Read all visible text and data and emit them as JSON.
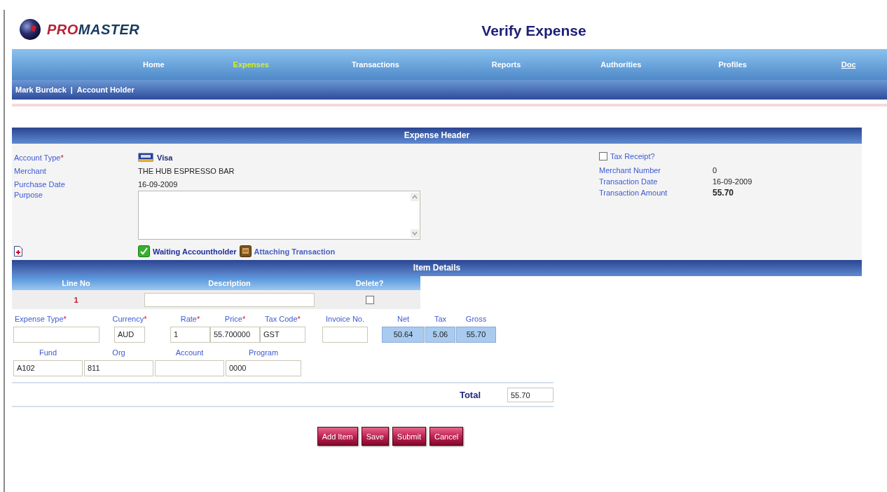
{
  "app": {
    "logo_parts": [
      {
        "text": "PRO",
        "kind": "accent"
      },
      {
        "text": "MASTER",
        "kind": "main"
      }
    ],
    "page_title": "Verify Expense"
  },
  "nav": [
    {
      "label": "Home",
      "selected": false
    },
    {
      "label": "Expenses",
      "selected": true
    },
    {
      "label": "Transactions",
      "selected": false
    },
    {
      "label": "Reports",
      "selected": false
    },
    {
      "label": "Authorities",
      "selected": false
    },
    {
      "label": "Profiles",
      "selected": false
    },
    {
      "label": "Doc",
      "selected": false,
      "kind": "link"
    }
  ],
  "user_bar": {
    "name": "Mark Burdack",
    "separator": "|",
    "role": "Account Holder"
  },
  "expense_header": {
    "title": "Expense Header",
    "left_fields": [
      {
        "label": "Account Type",
        "required": "*",
        "value": "Visa",
        "kind": "card"
      },
      {
        "label": "Merchant",
        "value": "THE HUB ESPRESSO BAR",
        "kind": "text"
      },
      {
        "label": "Purchase Date",
        "value": "16-09-2009",
        "kind": "text"
      },
      {
        "label": "Purpose",
        "kind": "textarea"
      }
    ],
    "tax_receipt": {
      "label": "Tax Receipt?",
      "checked": false
    },
    "right_fields": [
      {
        "label": "Merchant Number",
        "value": "0",
        "kind": "text"
      },
      {
        "label": "Transaction Date",
        "value": "16-09-2009",
        "kind": "text"
      },
      {
        "label": "Transaction Amount",
        "value": "55.70",
        "kind": "bold"
      }
    ],
    "statuses": [
      {
        "label": "Waiting Accountholder",
        "kind": "check"
      },
      {
        "label": "Attaching Transaction",
        "kind": "attach"
      }
    ]
  },
  "item_details": {
    "title": "Item Details",
    "columns": [
      "Line No",
      "Description",
      "Delete?"
    ],
    "rows": [
      {
        "line_no": "1",
        "delete": false
      }
    ],
    "line_fields": [
      {
        "label": "Expense Type",
        "required": "*",
        "kind": "input"
      },
      {
        "label": "Currency",
        "required": "*",
        "value": "AUD",
        "kind": "input"
      },
      {
        "label": "Rate",
        "required": "*",
        "value": "1",
        "kind": "input"
      },
      {
        "label": "Price",
        "required": "*",
        "value": "55.700000",
        "kind": "input"
      },
      {
        "label": "Tax Code",
        "required": "*",
        "value": "GST",
        "kind": "input"
      },
      {
        "label": "Invoice No.",
        "kind": "input"
      },
      {
        "label": "Net",
        "value": "50.64",
        "kind": "readonly"
      },
      {
        "label": "Tax",
        "value": "5.06",
        "kind": "readonly"
      },
      {
        "label": "Gross",
        "value": "55.70",
        "kind": "readonly"
      }
    ],
    "account_fields": [
      {
        "label": "Fund",
        "value": "A102"
      },
      {
        "label": "Org",
        "value": "811"
      },
      {
        "label": "Account"
      },
      {
        "label": "Program",
        "value": "0000"
      }
    ],
    "total": {
      "label": "Total",
      "value": "55.70"
    }
  },
  "buttons": [
    "Add Item",
    "Save",
    "Submit",
    "Cancel"
  ]
}
